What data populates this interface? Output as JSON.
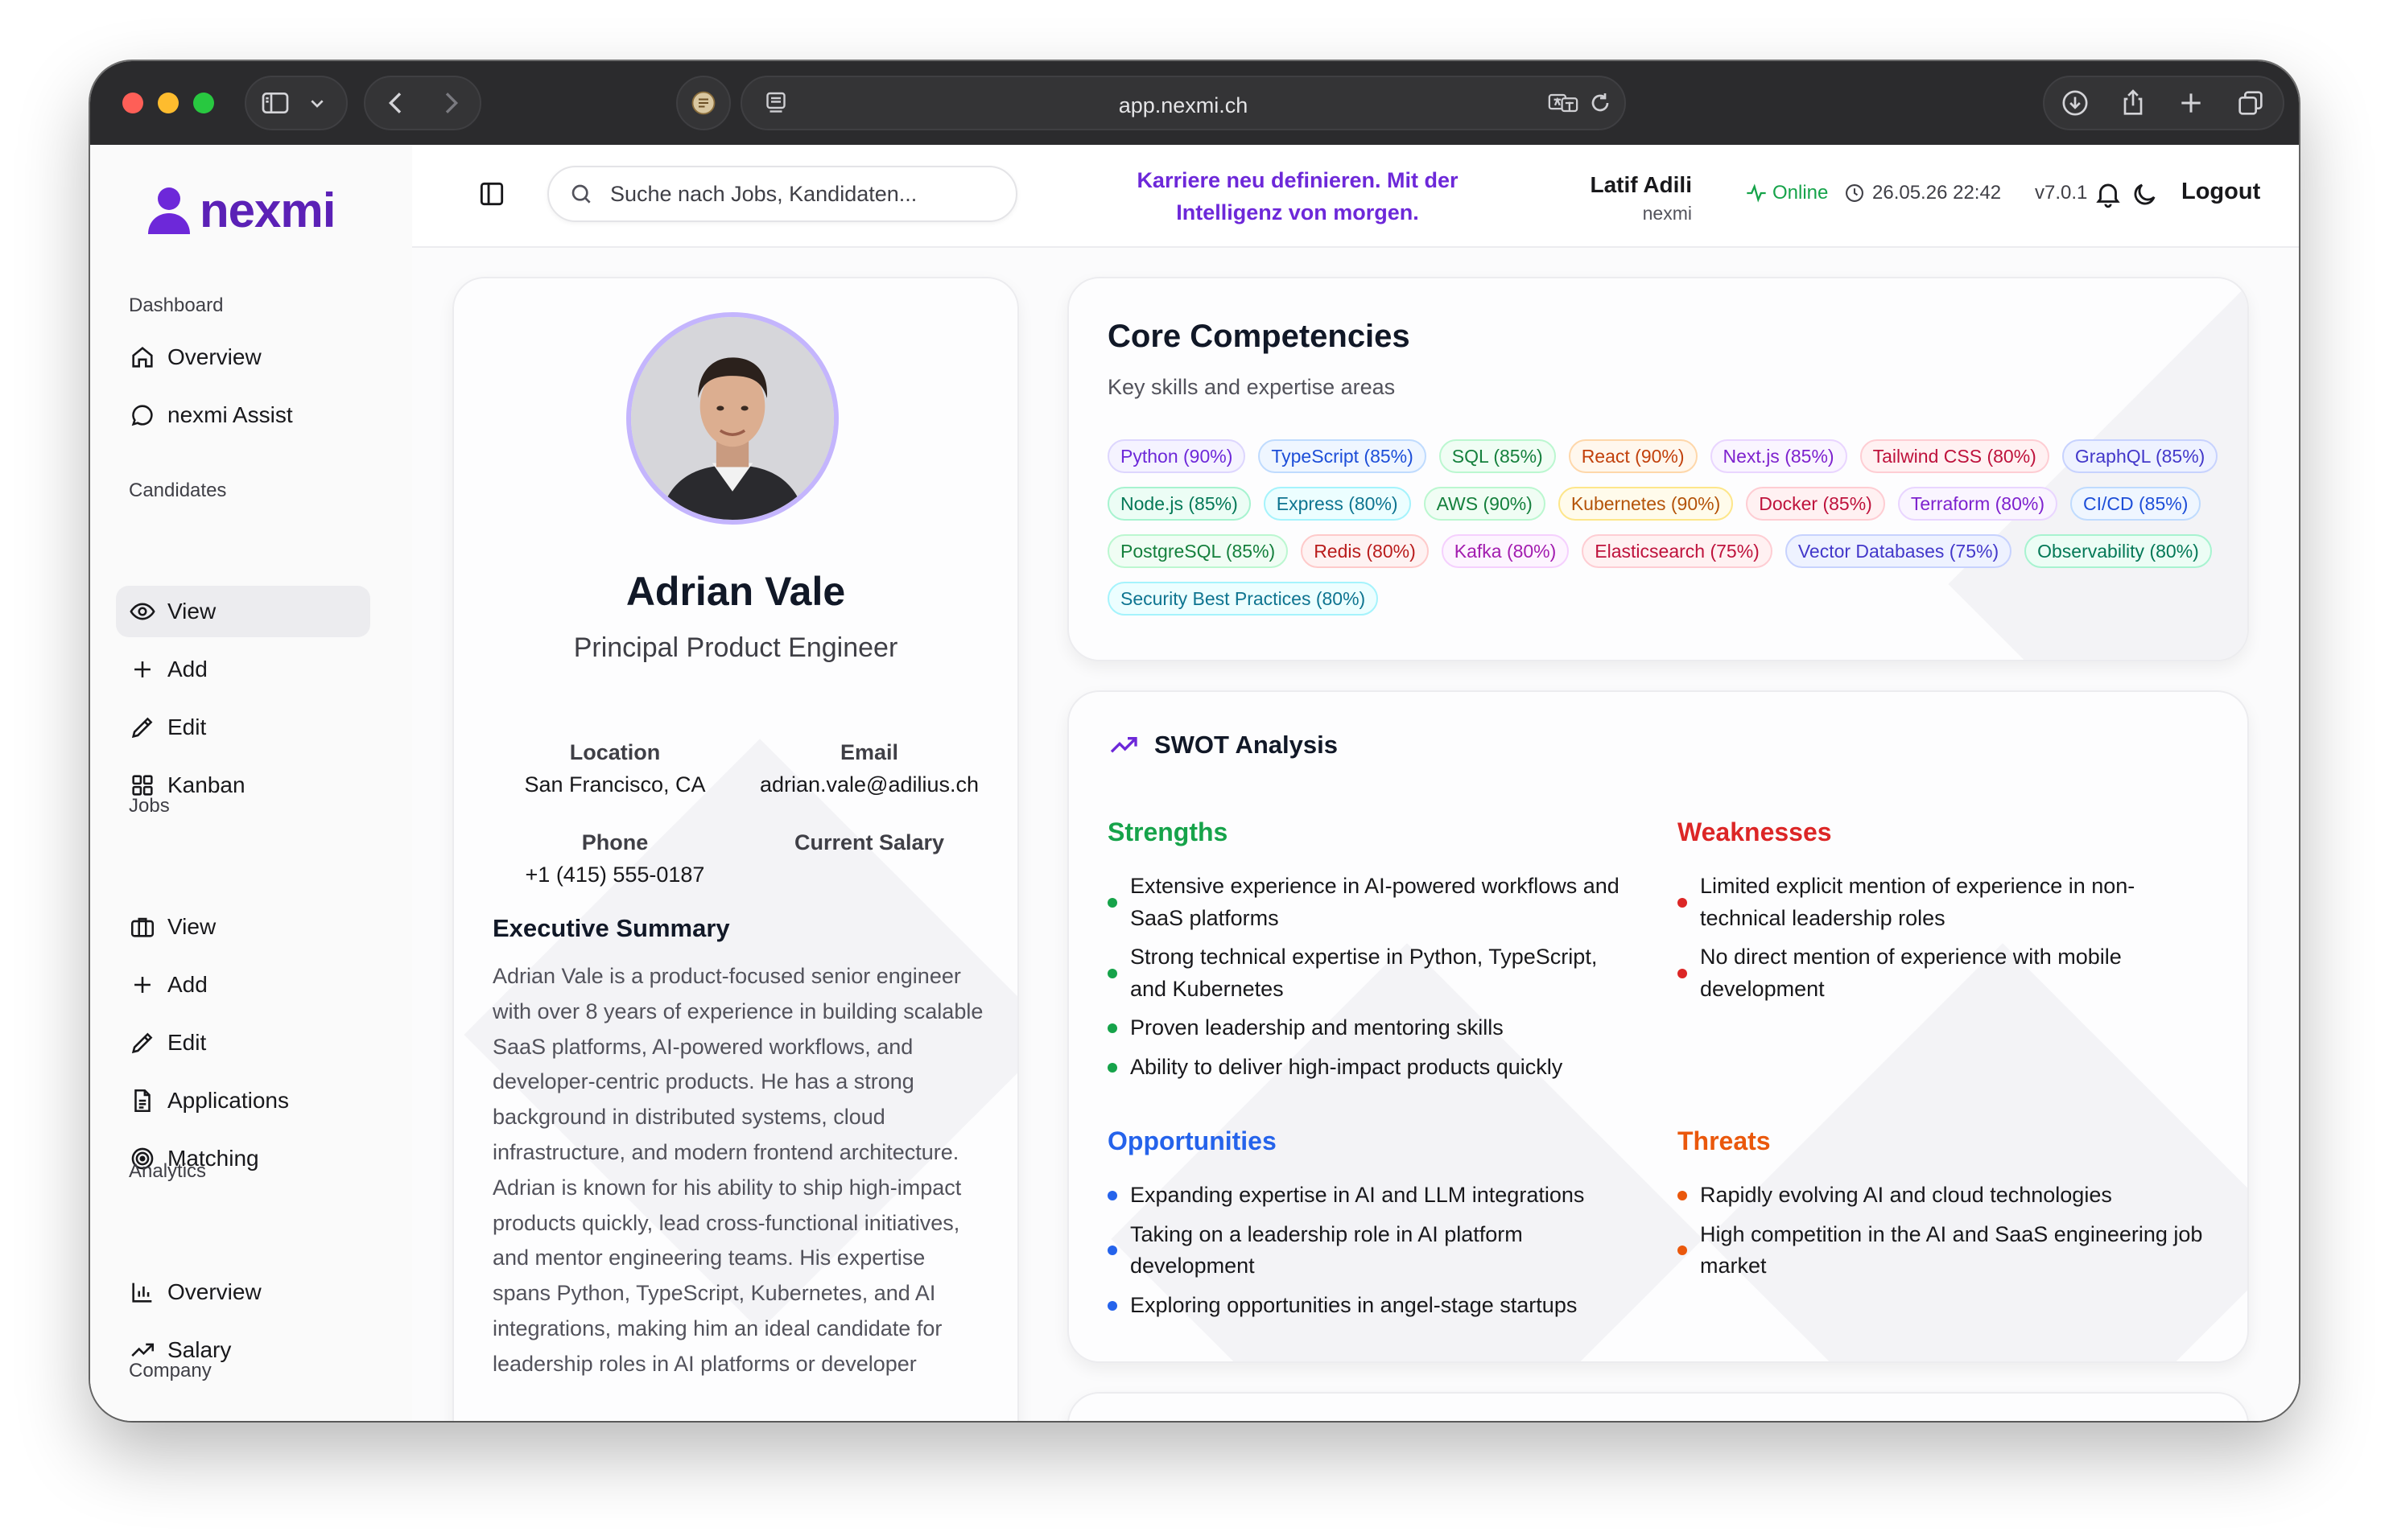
{
  "browser": {
    "url": "app.nexmi.ch"
  },
  "sidebar": {
    "brand": "nexmi",
    "sections": [
      {
        "title": "Dashboard",
        "items": [
          {
            "label": "Overview",
            "icon": "home-icon"
          },
          {
            "label": "nexmi Assist",
            "icon": "chat-bubble-icon"
          }
        ]
      },
      {
        "title": "Candidates",
        "items": [
          {
            "label": "View",
            "icon": "eye-icon",
            "active": true
          },
          {
            "label": "Add",
            "icon": "plus-icon"
          },
          {
            "label": "Edit",
            "icon": "pencil-icon"
          },
          {
            "label": "Kanban",
            "icon": "grid-icon"
          }
        ]
      },
      {
        "title": "Jobs",
        "items": [
          {
            "label": "View",
            "icon": "briefcase-icon"
          },
          {
            "label": "Add",
            "icon": "plus-icon"
          },
          {
            "label": "Edit",
            "icon": "pencil-icon"
          },
          {
            "label": "Applications",
            "icon": "document-icon"
          },
          {
            "label": "Matching",
            "icon": "target-icon"
          }
        ]
      },
      {
        "title": "Analytics",
        "items": [
          {
            "label": "Overview",
            "icon": "bar-chart-icon"
          },
          {
            "label": "Salary",
            "icon": "trend-up-icon"
          }
        ]
      },
      {
        "title": "Company",
        "items": []
      }
    ]
  },
  "header": {
    "search_placeholder": "Suche nach Jobs, Kandidaten...",
    "tagline_line1": "Karriere neu definieren. Mit der",
    "tagline_line2": "Intelligenz von morgen.",
    "user_name": "Latif Adili",
    "user_org": "nexmi",
    "status": "Online",
    "datetime": "26.05.26 22:42",
    "version": "v7.0.1",
    "logout_label": "Logout"
  },
  "profile": {
    "name": "Adrian Vale",
    "title": "Principal Product Engineer",
    "location_label": "Location",
    "location": "San Francisco, CA",
    "email_label": "Email",
    "email": "adrian.vale@adilius.ch",
    "phone_label": "Phone",
    "phone": "+1 (415) 555-0187",
    "salary_label": "Current Salary",
    "summary_title": "Executive Summary",
    "summary": "Adrian Vale is a product-focused senior engineer with over 8 years of experience in building scalable SaaS platforms, AI-powered workflows, and developer-centric products. He has a strong background in distributed systems, cloud infrastructure, and modern frontend architecture. Adrian is known for his ability to ship high-impact products quickly, lead cross-functional initiatives, and mentor engineering teams. His expertise spans Python, TypeScript, Kubernetes, and AI integrations, making him an ideal candidate for leadership roles in AI platforms or developer"
  },
  "competencies": {
    "title": "Core Competencies",
    "subtitle": "Key skills and expertise areas",
    "tags": [
      {
        "label": "Python (90%)",
        "color": "#6d28d9",
        "bg": "#f5f3ff",
        "border": "#ddd6fe"
      },
      {
        "label": "TypeScript (85%)",
        "color": "#1d4ed8",
        "bg": "#eff6ff",
        "border": "#bfdbfe"
      },
      {
        "label": "SQL (85%)",
        "color": "#15803d",
        "bg": "#f0fdf4",
        "border": "#bbf7d0"
      },
      {
        "label": "React (90%)",
        "color": "#c2410c",
        "bg": "#fff7ed",
        "border": "#fed7aa"
      },
      {
        "label": "Next.js (85%)",
        "color": "#7e22ce",
        "bg": "#faf5ff",
        "border": "#e9d5ff"
      },
      {
        "label": "Tailwind CSS (80%)",
        "color": "#be123c",
        "bg": "#fff1f2",
        "border": "#fecdd3"
      },
      {
        "label": "GraphQL (85%)",
        "color": "#4338ca",
        "bg": "#eef2ff",
        "border": "#c7d2fe"
      },
      {
        "label": "Node.js (85%)",
        "color": "#047857",
        "bg": "#ecfdf5",
        "border": "#a7f3d0"
      },
      {
        "label": "Express (80%)",
        "color": "#0e7490",
        "bg": "#ecfeff",
        "border": "#a5f3fc"
      },
      {
        "label": "AWS (90%)",
        "color": "#15803d",
        "bg": "#f0fdf4",
        "border": "#bbf7d0"
      },
      {
        "label": "Kubernetes (90%)",
        "color": "#b45309",
        "bg": "#fffbeb",
        "border": "#fde68a"
      },
      {
        "label": "Docker (85%)",
        "color": "#be123c",
        "bg": "#fff1f2",
        "border": "#fecdd3"
      },
      {
        "label": "Terraform (80%)",
        "color": "#7e22ce",
        "bg": "#faf5ff",
        "border": "#e9d5ff"
      },
      {
        "label": "CI/CD (85%)",
        "color": "#1d4ed8",
        "bg": "#eff6ff",
        "border": "#bfdbfe"
      },
      {
        "label": "PostgreSQL (85%)",
        "color": "#15803d",
        "bg": "#f0fdf4",
        "border": "#bbf7d0"
      },
      {
        "label": "Redis (80%)",
        "color": "#b91c1c",
        "bg": "#fef2f2",
        "border": "#fecaca"
      },
      {
        "label": "Kafka (80%)",
        "color": "#a21caf",
        "bg": "#fdf4ff",
        "border": "#f5d0fe"
      },
      {
        "label": "Elasticsearch (75%)",
        "color": "#be123c",
        "bg": "#fff1f2",
        "border": "#fecdd3"
      },
      {
        "label": "Vector Databases (75%)",
        "color": "#4338ca",
        "bg": "#eef2ff",
        "border": "#c7d2fe"
      },
      {
        "label": "Observability (80%)",
        "color": "#047857",
        "bg": "#ecfdf5",
        "border": "#a7f3d0"
      },
      {
        "label": "Security Best Practices (80%)",
        "color": "#0e7490",
        "bg": "#ecfeff",
        "border": "#a5f3fc"
      }
    ]
  },
  "swot": {
    "title": "SWOT Analysis",
    "strengths": {
      "title": "Strengths",
      "color": "#16a34a",
      "items": [
        "Extensive experience in AI-powered workflows and SaaS platforms",
        "Strong technical expertise in Python, TypeScript, and Kubernetes",
        "Proven leadership and mentoring skills",
        "Ability to deliver high-impact products quickly"
      ]
    },
    "weaknesses": {
      "title": "Weaknesses",
      "color": "#dc2626",
      "items": [
        "Limited explicit mention of experience in non-technical leadership roles",
        "No direct mention of experience with mobile development"
      ]
    },
    "opportunities": {
      "title": "Opportunities",
      "color": "#2563eb",
      "items": [
        "Expanding expertise in AI and LLM integrations",
        "Taking on a leadership role in AI platform development",
        "Exploring opportunities in angel-stage startups"
      ]
    },
    "threats": {
      "title": "Threats",
      "color": "#ea580c",
      "items": [
        "Rapidly evolving AI and cloud technologies",
        "High competition in the AI and SaaS engineering job market"
      ]
    }
  }
}
